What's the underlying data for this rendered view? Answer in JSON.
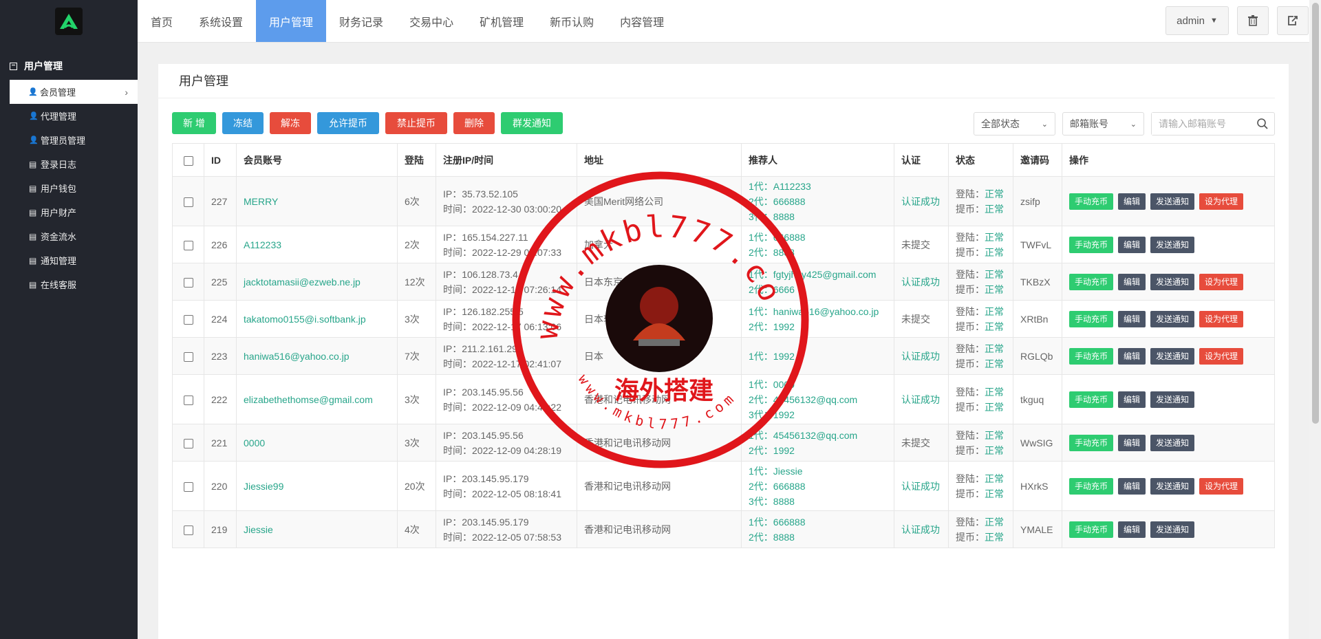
{
  "topnav": [
    "首页",
    "系统设置",
    "用户管理",
    "财务记录",
    "交易中心",
    "矿机管理",
    "新币认购",
    "内容管理"
  ],
  "active_nav": 2,
  "user_menu": "admin",
  "sidebar": {
    "group": "用户管理",
    "items": [
      {
        "label": "会员管理",
        "icon": "user-icon"
      },
      {
        "label": "代理管理",
        "icon": "user-icon"
      },
      {
        "label": "管理员管理",
        "icon": "user-icon"
      },
      {
        "label": "登录日志",
        "icon": "list-icon"
      },
      {
        "label": "用户钱包",
        "icon": "list-icon"
      },
      {
        "label": "用户财产",
        "icon": "list-icon"
      },
      {
        "label": "资金流水",
        "icon": "list-icon"
      },
      {
        "label": "通知管理",
        "icon": "list-icon"
      },
      {
        "label": "在线客服",
        "icon": "list-icon"
      }
    ]
  },
  "panel_title": "用户管理",
  "toolbar": {
    "add": "新 增",
    "freeze": "冻结",
    "unfreeze": "解冻",
    "allow_withdraw": "允许提币",
    "forbid_withdraw": "禁止提币",
    "delete": "删除",
    "mass_notify": "群发通知"
  },
  "filters": {
    "status": "全部状态",
    "type": "邮箱账号",
    "search_placeholder": "请输入邮箱账号"
  },
  "columns": [
    "ID",
    "会员账号",
    "登陆",
    "注册IP/时间",
    "地址",
    "推荐人",
    "认证",
    "状态",
    "邀请码",
    "操作"
  ],
  "rows": [
    {
      "id": "227",
      "account": "MERRY",
      "logins": "6次",
      "ip": "IP：35.73.52.105",
      "time": "时间：2022-12-30 03:00:20",
      "address": "美国Merit网络公司",
      "referrers": [
        "1代：A112233",
        "2代：666888",
        "3代：8888"
      ],
      "auth": "认证成功",
      "login_status": "正常",
      "withdraw_status": "正常",
      "invite": "zsifp",
      "agent": true
    },
    {
      "id": "226",
      "account": "A112233",
      "logins": "2次",
      "ip": "IP：165.154.227.11",
      "time": "时间：2022-12-29 07:07:33",
      "address": "加拿大",
      "referrers": [
        "1代：666888",
        "2代：8888"
      ],
      "auth": "未提交",
      "login_status": "正常",
      "withdraw_status": "正常",
      "invite": "TWFvL",
      "agent": false
    },
    {
      "id": "225",
      "account": "jacktotamasii@ezweb.ne.jp",
      "logins": "12次",
      "ip": "IP：106.128.73.4",
      "time": "时间：2022-12-18 07:26:14",
      "address": "日本东京电话公司",
      "referrers": [
        "1代：fgtyjhuy425@gmail.com",
        "2代：6666"
      ],
      "auth": "认证成功",
      "login_status": "正常",
      "withdraw_status": "正常",
      "invite": "TKBzX",
      "agent": true
    },
    {
      "id": "224",
      "account": "takatomo0155@i.softbank.jp",
      "logins": "3次",
      "ip": "IP：126.182.255.5",
      "time": "时间：2022-12-17 06:13:06",
      "address": "日本软银",
      "referrers": [
        "1代：haniwa516@yahoo.co.jp",
        "2代：1992"
      ],
      "auth": "未提交",
      "login_status": "正常",
      "withdraw_status": "正常",
      "invite": "XRtBn",
      "agent": true
    },
    {
      "id": "223",
      "account": "haniwa516@yahoo.co.jp",
      "logins": "7次",
      "ip": "IP：211.2.161.29",
      "time": "时间：2022-12-17 02:41:07",
      "address": "日本",
      "referrers": [
        "1代：1992"
      ],
      "auth": "认证成功",
      "login_status": "正常",
      "withdraw_status": "正常",
      "invite": "RGLQb",
      "agent": true
    },
    {
      "id": "222",
      "account": "elizabethethomse@gmail.com",
      "logins": "3次",
      "ip": "IP：203.145.95.56",
      "time": "时间：2022-12-09 04:48:22",
      "address": "香港和记电讯移动网",
      "referrers": [
        "1代：0000",
        "2代：45456132@qq.com",
        "3代：1992"
      ],
      "auth": "认证成功",
      "login_status": "正常",
      "withdraw_status": "正常",
      "invite": "tkguq",
      "agent": false
    },
    {
      "id": "221",
      "account": "0000",
      "logins": "3次",
      "ip": "IP：203.145.95.56",
      "time": "时间：2022-12-09 04:28:19",
      "address": "香港和记电讯移动网",
      "referrers": [
        "1代：45456132@qq.com",
        "2代：1992"
      ],
      "auth": "未提交",
      "login_status": "正常",
      "withdraw_status": "正常",
      "invite": "WwSIG",
      "agent": false
    },
    {
      "id": "220",
      "account": "Jiessie99",
      "logins": "20次",
      "ip": "IP：203.145.95.179",
      "time": "时间：2022-12-05 08:18:41",
      "address": "香港和记电讯移动网",
      "referrers": [
        "1代：Jiessie",
        "2代：666888",
        "3代：8888"
      ],
      "auth": "认证成功",
      "login_status": "正常",
      "withdraw_status": "正常",
      "invite": "HXrkS",
      "agent": true
    },
    {
      "id": "219",
      "account": "Jiessie",
      "logins": "4次",
      "ip": "IP：203.145.95.179",
      "time": "时间：2022-12-05 07:58:53",
      "address": "香港和记电讯移动网",
      "referrers": [
        "1代：666888",
        "2代：8888"
      ],
      "auth": "认证成功",
      "login_status": "正常",
      "withdraw_status": "正常",
      "invite": "YMALE",
      "agent": false
    }
  ],
  "labels": {
    "login": "登陆：",
    "withdraw": "提币："
  },
  "actions": {
    "manual": "手动充币",
    "edit": "编辑",
    "notify": "发送通知",
    "agent": "设为代理"
  },
  "watermark": {
    "url_top": "www.mkbl777.com",
    "url_bottom": "www.mkbl777.com",
    "caption": "海外搭建",
    "color": "#e0161b"
  }
}
